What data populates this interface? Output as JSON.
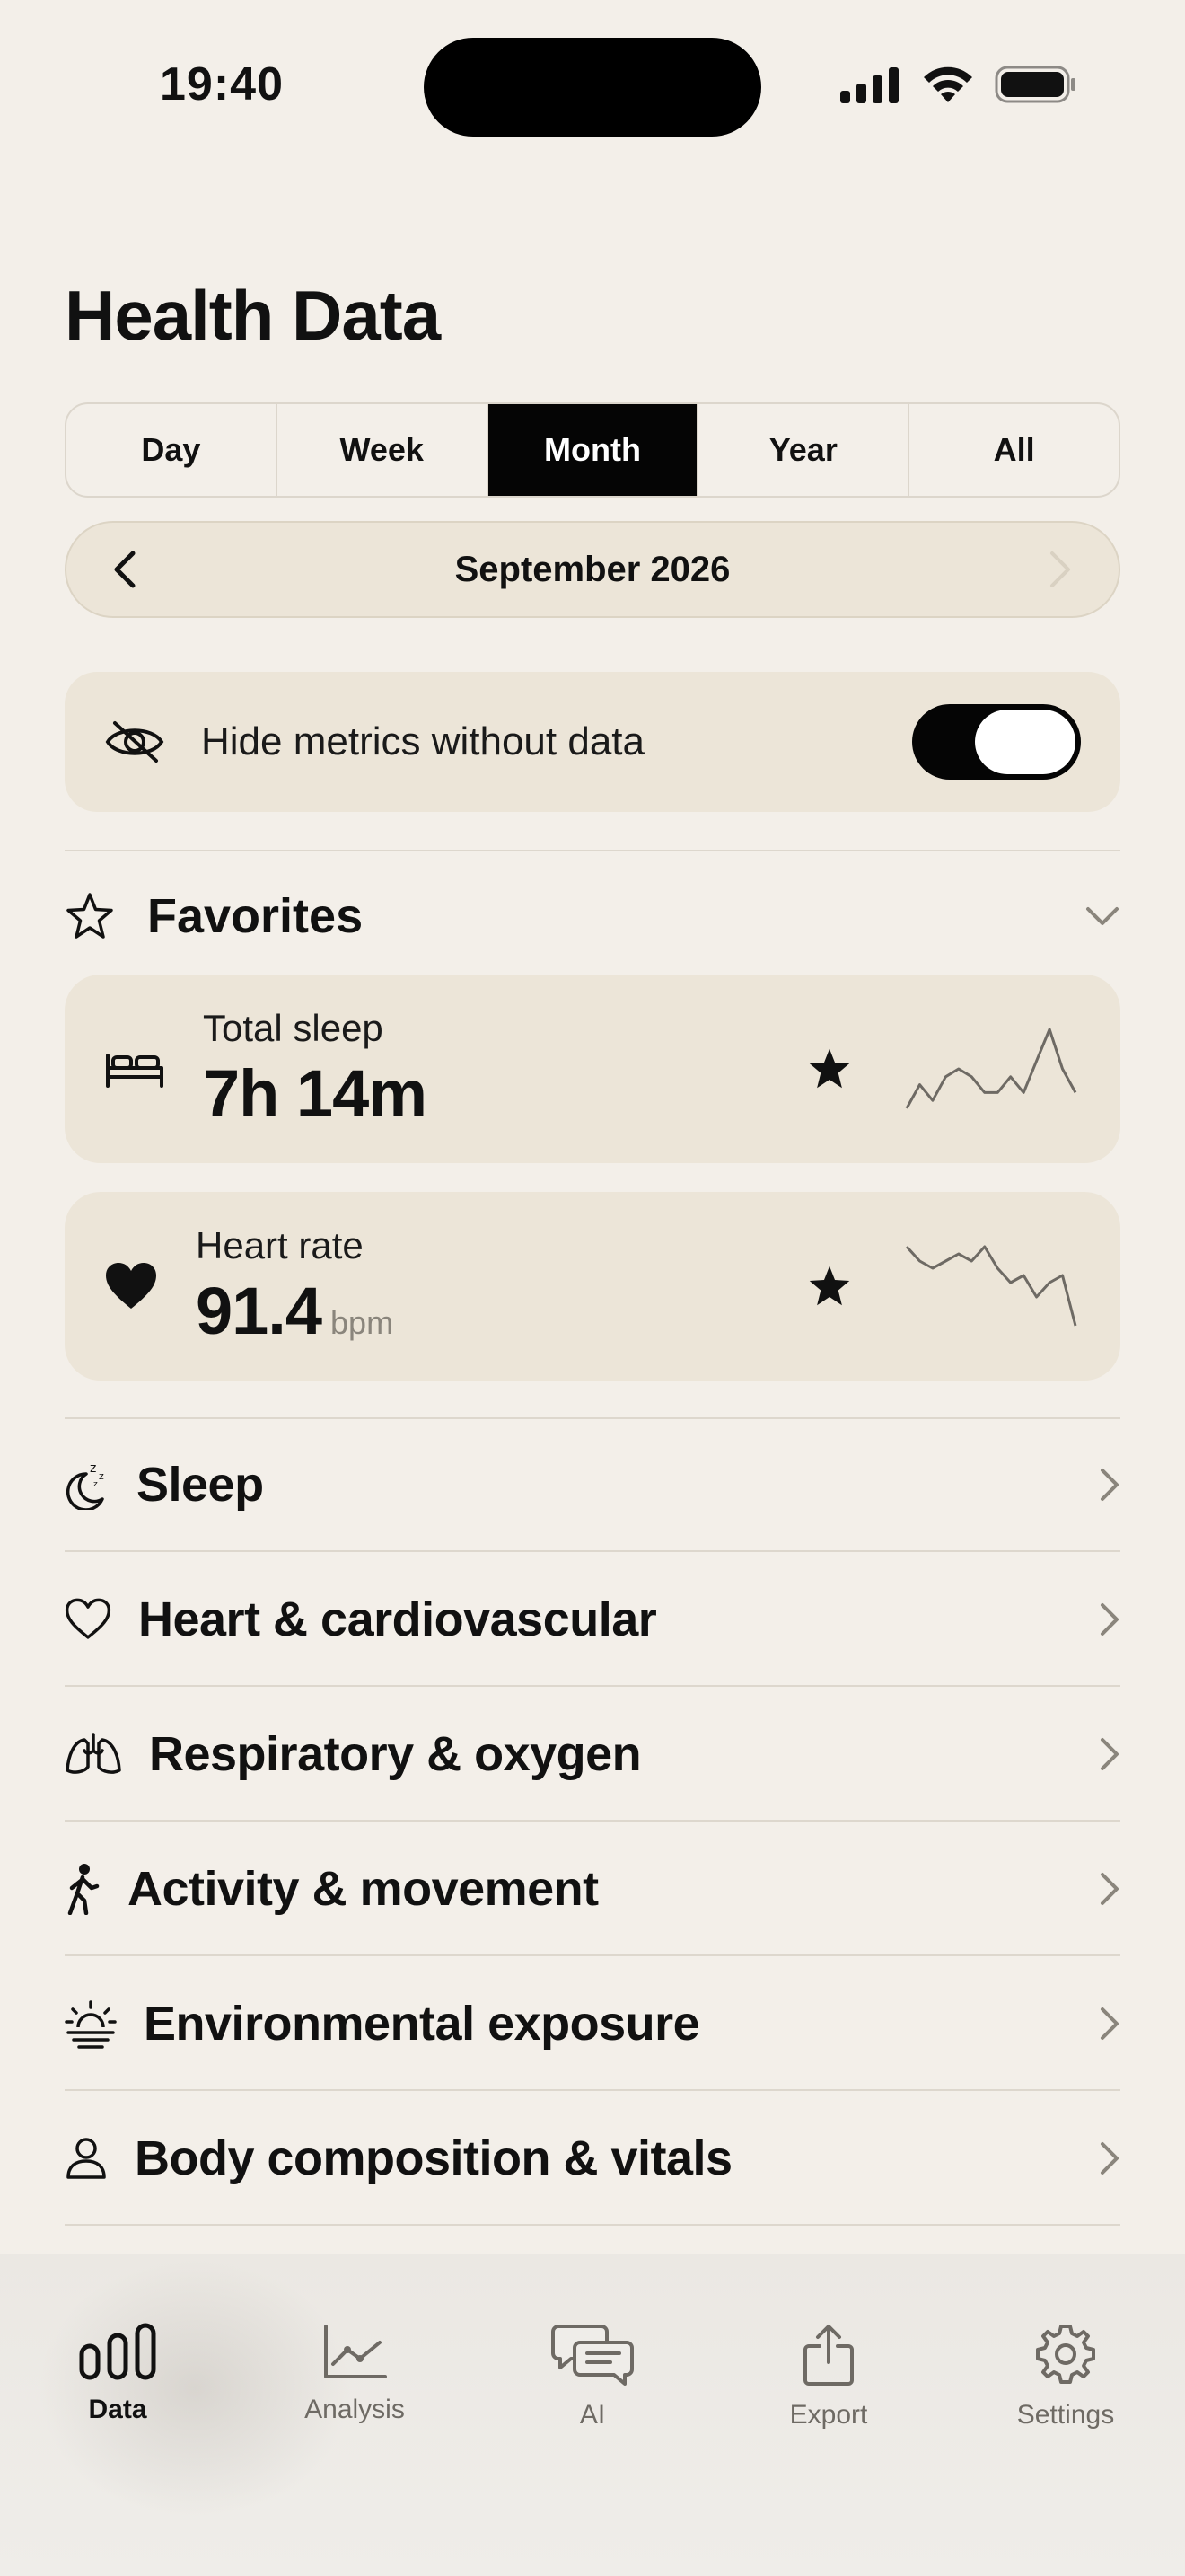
{
  "status": {
    "time": "19:40"
  },
  "title": "Health Data",
  "period_tabs": [
    "Day",
    "Week",
    "Month",
    "Year",
    "All"
  ],
  "active_period": "Month",
  "month_nav": {
    "label": "September 2026"
  },
  "hide_metrics": {
    "label": "Hide metrics without data",
    "enabled": true
  },
  "favorites": {
    "title": "Favorites",
    "items": [
      {
        "name": "Total sleep",
        "value": "7h 14m",
        "unit": "",
        "icon": "bed-icon",
        "starred": true,
        "sparkline": [
          3,
          6,
          4,
          7,
          8,
          7,
          5,
          5,
          7,
          5,
          9,
          13,
          8,
          5
        ]
      },
      {
        "name": "Heart rate",
        "value": "91.4",
        "unit": "bpm",
        "icon": "heart-icon",
        "starred": true,
        "sparkline": [
          12,
          10,
          9,
          10,
          11,
          10,
          12,
          9,
          7,
          8,
          5,
          7,
          8,
          1
        ]
      }
    ]
  },
  "categories": [
    {
      "label": "Sleep",
      "icon": "moon-sleep-icon"
    },
    {
      "label": "Heart & cardiovascular",
      "icon": "heart-outline-icon"
    },
    {
      "label": "Respiratory & oxygen",
      "icon": "lungs-icon"
    },
    {
      "label": "Activity & movement",
      "icon": "walking-icon"
    },
    {
      "label": "Environmental exposure",
      "icon": "sunrise-icon"
    },
    {
      "label": "Body composition & vitals",
      "icon": "person-icon"
    }
  ],
  "tabbar": {
    "active": "Data",
    "items": [
      {
        "label": "Data",
        "icon": "bar-chart-icon"
      },
      {
        "label": "Analysis",
        "icon": "line-chart-icon"
      },
      {
        "label": "AI",
        "icon": "chat-bubbles-icon"
      },
      {
        "label": "Export",
        "icon": "share-icon"
      },
      {
        "label": "Settings",
        "icon": "gear-icon"
      }
    ]
  },
  "colors": {
    "background": "#f3efe9",
    "card": "#ece5d8",
    "accent": "#050505"
  }
}
